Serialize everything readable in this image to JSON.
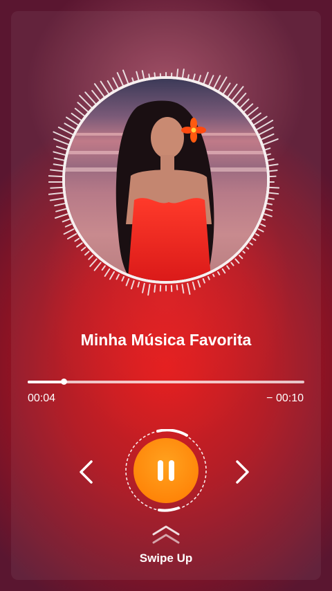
{
  "player": {
    "song_title": "Minha Música Favorita",
    "elapsed": "00:04",
    "remaining": "− 00:10",
    "progress": 0.13
  },
  "controls": {
    "prev_icon": "chevron-left-icon",
    "play_state_icon": "pause-icon",
    "next_icon": "chevron-right-icon",
    "accent_color": "#ff8a00"
  },
  "swipe": {
    "label": "Swipe Up",
    "icon": "double-chevron-up-icon"
  }
}
